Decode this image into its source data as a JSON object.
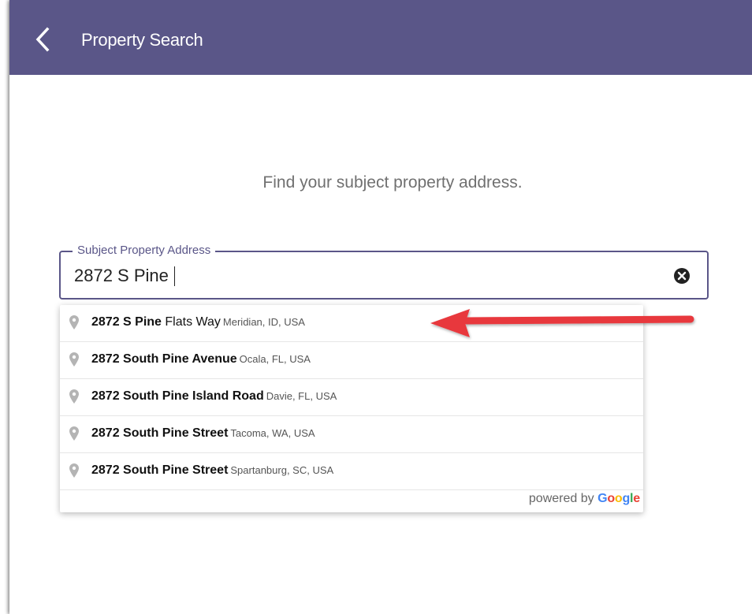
{
  "header": {
    "title": "Property Search",
    "back_icon": "chevron-left-icon",
    "background_color": "#5a5688"
  },
  "prompt": "Find your subject property address.",
  "address_field": {
    "label": "Subject Property Address",
    "value": "2872 S Pine",
    "clear_icon": "clear-circle-icon"
  },
  "suggestions": [
    {
      "main_bold": "2872 S Pine",
      "main_rest": " Flats Way",
      "secondary": "Meridian, ID, USA"
    },
    {
      "main_bold": "2872 South Pine Avenue",
      "main_rest": "",
      "secondary": "Ocala, FL, USA"
    },
    {
      "main_bold": "2872 South Pine Island Road",
      "main_rest": "",
      "secondary": "Davie, FL, USA"
    },
    {
      "main_bold": "2872 South Pine Street",
      "main_rest": "",
      "secondary": "Tacoma, WA, USA"
    },
    {
      "main_bold": "2872 South Pine Street",
      "main_rest": "",
      "secondary": "Spartanburg, SC, USA"
    }
  ],
  "powered_by": {
    "prefix": "powered by",
    "brand_letters": [
      "G",
      "o",
      "o",
      "g",
      "l",
      "e"
    ],
    "brand_colors": [
      "#4285F4",
      "#EA4335",
      "#FBBC05",
      "#4285F4",
      "#34A853",
      "#EA4335"
    ]
  },
  "annotation": {
    "arrow_color": "#e8383d"
  }
}
